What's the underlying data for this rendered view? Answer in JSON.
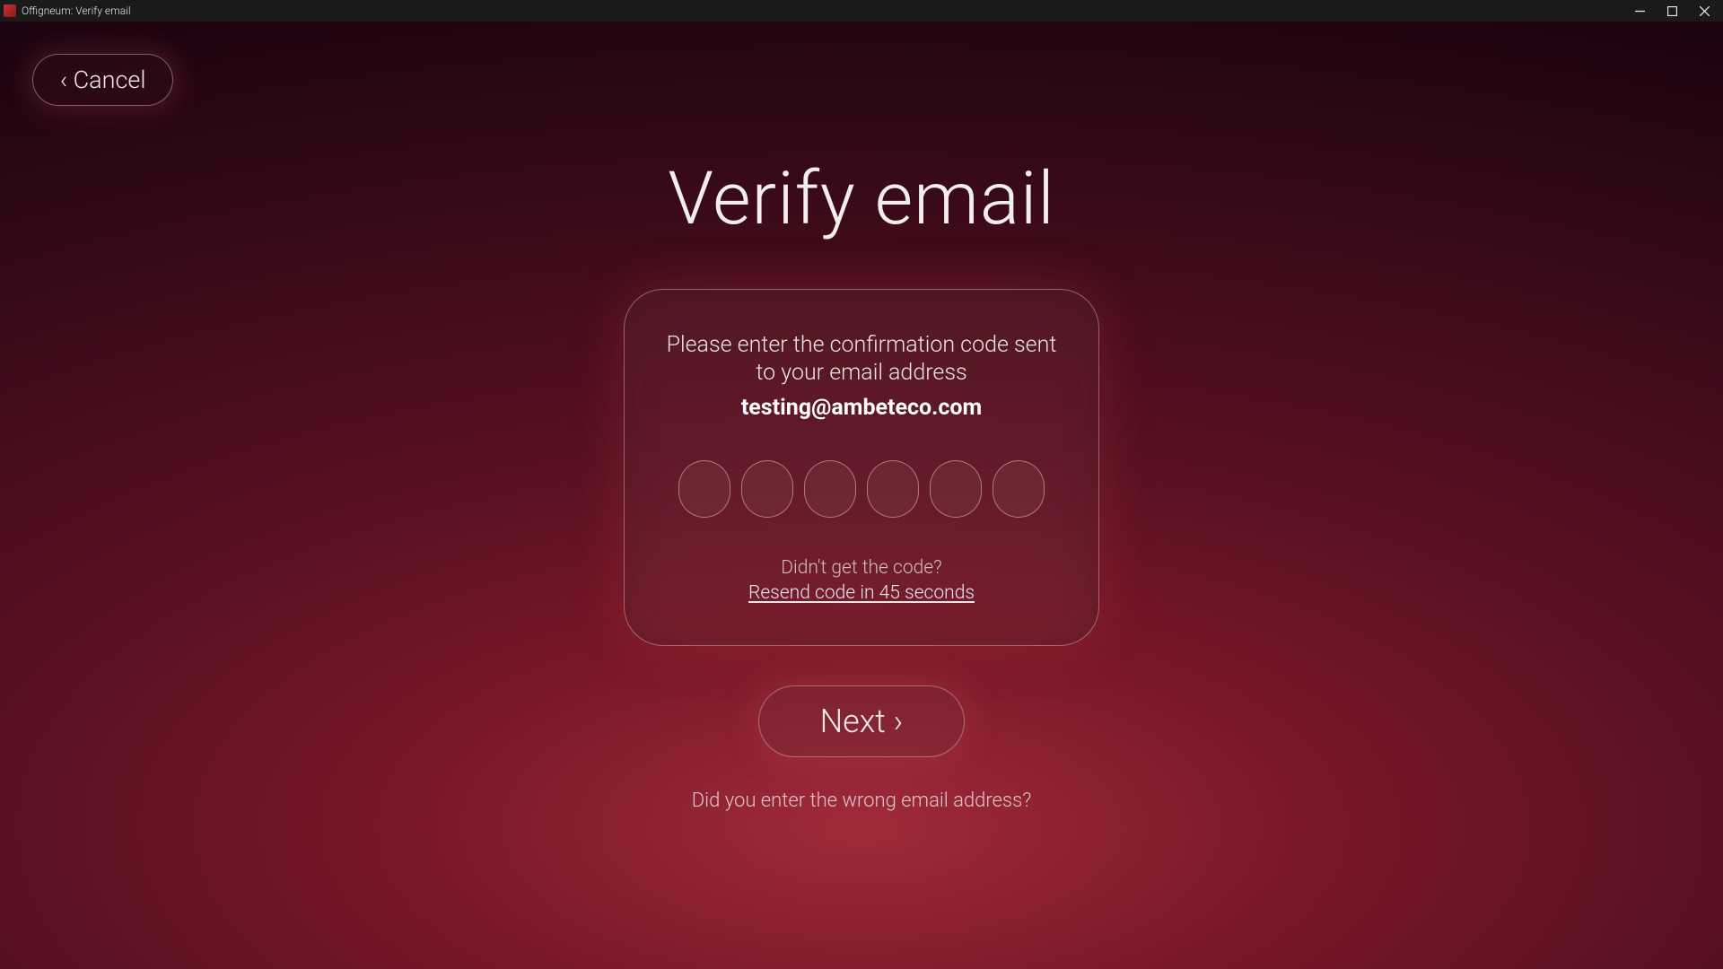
{
  "window": {
    "title": "Offigneum: Verify email"
  },
  "cancel_label": "‹ Cancel",
  "page_title": "Verify email",
  "card": {
    "prompt": "Please enter the confirmation code sent to your email address",
    "email": "testing@ambeteco.com",
    "code_digit_count": 6,
    "resend_question": "Didn't get the code?",
    "resend_label": "Resend code in 45 seconds"
  },
  "next_label": "Next ›",
  "wrong_email_text": "Did you enter the wrong email address?"
}
